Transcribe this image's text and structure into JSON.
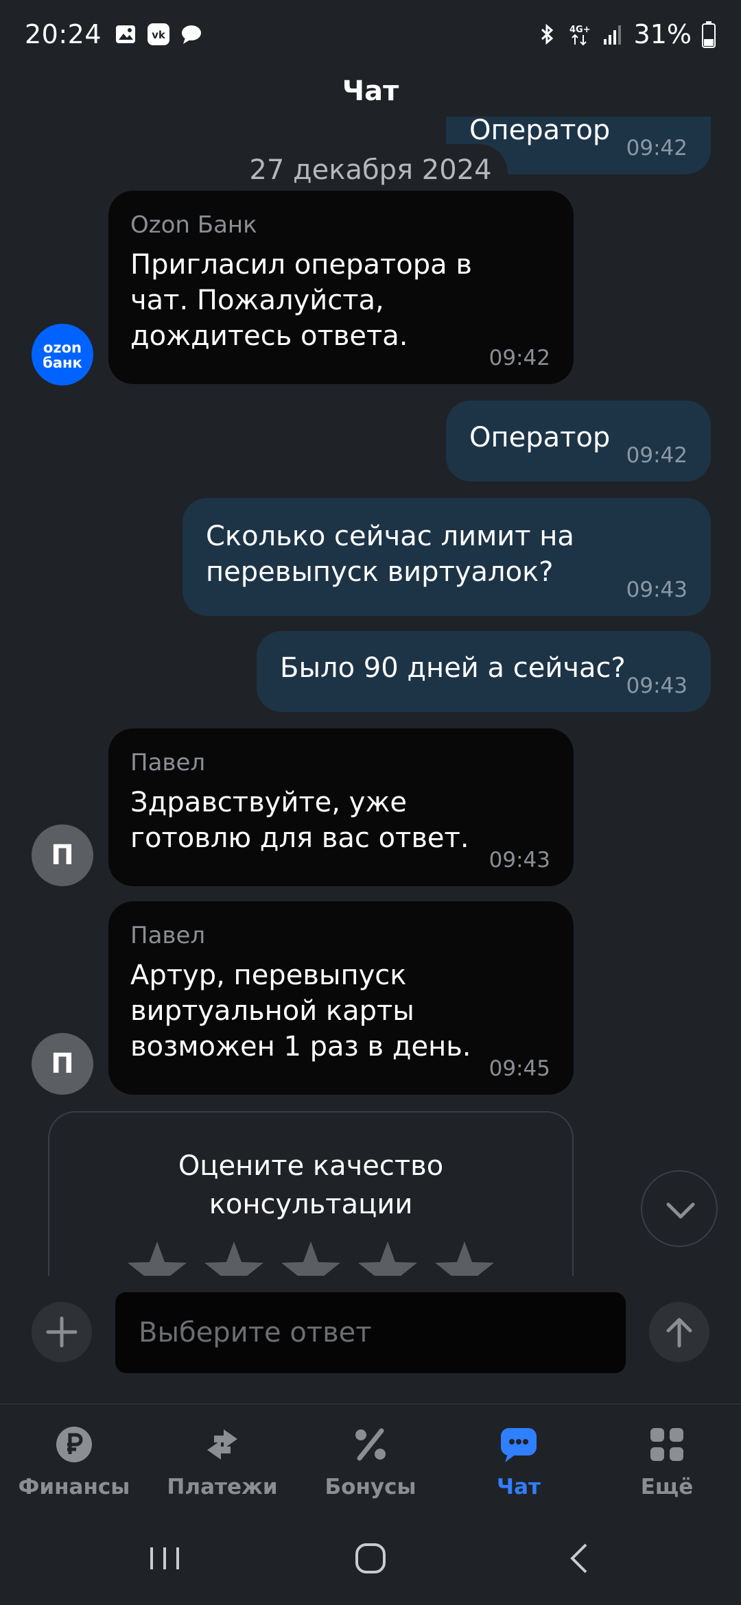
{
  "status_bar": {
    "time": "20:24",
    "left_icons": [
      "gallery-icon",
      "vk-icon",
      "message-icon"
    ],
    "right_icons": [
      "bluetooth-icon",
      "4g-icon",
      "signal-icon"
    ],
    "battery": "31%"
  },
  "header": {
    "title": "Чат"
  },
  "chat": {
    "date": "27 декабря 2024",
    "messages": [
      {
        "type": "outgoing",
        "text": "Оператор",
        "time": "09:42"
      },
      {
        "type": "incoming",
        "sender": "Ozon Банк",
        "text": "Пригласил оператора в чат. Пожалуйста, дождитесь ответа.",
        "lines": [
          "Пригласил оператора в",
          "чат. Пожалуйста,",
          "дождитесь ответа."
        ],
        "time": "09:42",
        "avatar": "ozon\nбанк"
      },
      {
        "type": "outgoing",
        "text": "Оператор",
        "time": "09:42"
      },
      {
        "type": "outgoing",
        "text": "Сколько сейчас лимит на перевыпуск виртуалок?",
        "lines": [
          "Сколько сейчас лимит на",
          "перевыпуск виртуалок?"
        ],
        "time": "09:43"
      },
      {
        "type": "outgoing",
        "text": "Было 90 дней а сейчас?",
        "time": "09:43"
      },
      {
        "type": "incoming",
        "sender": "Павел",
        "text": "Здравствуйте, уже готовлю для вас ответ.",
        "lines": [
          "Здравствуйте, уже",
          "готовлю для вас ответ."
        ],
        "time": "09:43",
        "avatar": "П"
      },
      {
        "type": "incoming",
        "sender": "Павел",
        "text": "Артур, перевыпуск виртуальной карты возможен 1 раз в день.",
        "lines": [
          "Артур, перевыпуск",
          "виртуальной карты",
          "возможен 1 раз в день."
        ],
        "time": "09:45",
        "avatar": "П"
      }
    ],
    "avatar_ozon_line1": "ozon",
    "avatar_ozon_line2": "банк"
  },
  "rating": {
    "title": "Оцените качество консультации",
    "stars": 5
  },
  "input": {
    "placeholder": "Выберите ответ"
  },
  "nav": {
    "items": [
      {
        "label": "Финансы",
        "icon": "ruble-icon",
        "active": false
      },
      {
        "label": "Платежи",
        "icon": "transfer-arrows-icon",
        "active": false
      },
      {
        "label": "Бонусы",
        "icon": "percent-icon",
        "active": false
      },
      {
        "label": "Чат",
        "icon": "chat-icon",
        "active": true
      },
      {
        "label": "Ещё",
        "icon": "grid-icon",
        "active": false
      }
    ]
  },
  "colors": {
    "accent": "#2f7fff",
    "ozon_blue": "#0063ff",
    "outgoing_bubble": "#1d3447",
    "incoming_bubble": "#080808",
    "background": "#1f2227"
  }
}
